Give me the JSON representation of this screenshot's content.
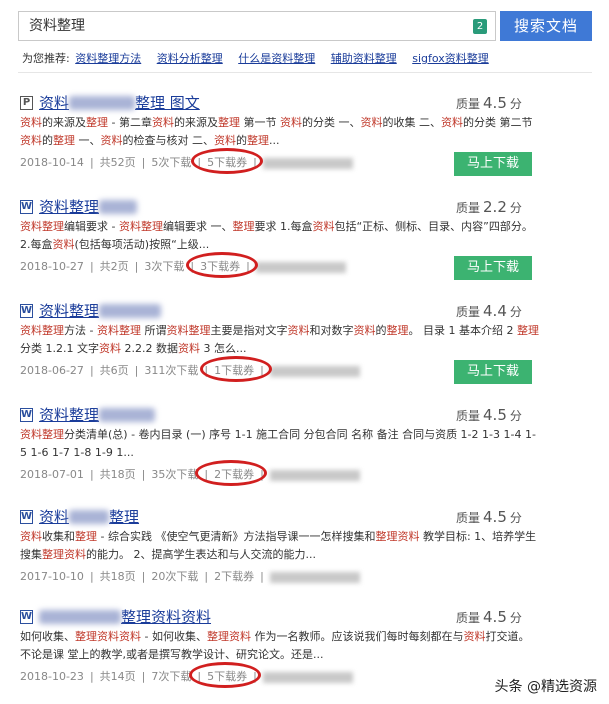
{
  "search": {
    "value": "资料整理",
    "count": "2",
    "button": "搜索文档"
  },
  "suggest": {
    "label": "为您推荐:",
    "links": [
      "资料整理方法",
      "资料分析整理",
      "什么是资料整理",
      "辅助资料整理",
      "sigfox资料整理"
    ]
  },
  "quality_label": "质量",
  "score_unit": "分",
  "download_button": "马上下载",
  "results": [
    {
      "icon": "P",
      "title_a": "资料",
      "title_b": "整理 图文",
      "score": "4.5",
      "snippet": "资料的来源及整理 - 第二章资料的来源及整理 第一节 资料的分类 一、资料的收集 二、资料的分类 第二节 资料的整理 一、资料的检查与核对 二、资料的整理...",
      "date": "2018-10-14",
      "pages": "共52页",
      "downloads": "5次下载",
      "coupon": "5下载券"
    },
    {
      "icon": "W",
      "title_a": "资料整理",
      "title_b": "",
      "score": "2.2",
      "snippet": "资料整理编辑要求 - 资料整理编辑要求 一、整理要求 1.每盒资料包括“正标、侧标、目录、内容”四部分。 2.每盒资料(包括每项活动)按照“上级...",
      "date": "2018-10-27",
      "pages": "共2页",
      "downloads": "3次下载",
      "coupon": "3下载券"
    },
    {
      "icon": "W",
      "title_a": "资料整理",
      "title_b": "",
      "score": "4.4",
      "snippet": "资料整理方法 - 资料整理 所谓资料整理主要是指对文字资料和对数字资料的整理。 目录 1 基本介绍 2 整理分类 1.2.1 文字资料 2.2.2 数据资料 3 怎么...",
      "date": "2018-06-27",
      "pages": "共6页",
      "downloads": "311次下载",
      "coupon": "1下载券"
    },
    {
      "icon": "W",
      "title_a": "资料整理",
      "title_b": "",
      "score": "4.5",
      "snippet": "资料整理分类清单(总) - 卷内目录 (一) 序号 1-1 施工合同 分包合同 名称 备注 合同与资质 1-2 1-3 1-4 1-5 1-6 1-7 1-8 1-9 1...",
      "date": "2018-07-01",
      "pages": "共18页",
      "downloads": "35次下载",
      "coupon": "2下载券"
    },
    {
      "icon": "W",
      "title_a": "资料",
      "title_b": "整理",
      "score": "4.5",
      "snippet": "资料收集和整理 - 综合实践 《使空气更清新》方法指导课一一怎样搜集和整理资料 教学目标: 1、培养学生搜集整理资料的能力。 2、提高学生表达和与人交流的能力...",
      "date": "2017-10-10",
      "pages": "共18页",
      "downloads": "20次下载",
      "coupon": "2下载券"
    },
    {
      "icon": "W",
      "title_a": "",
      "title_b": "整理资料资料",
      "score": "4.5",
      "snippet": "如何收集、整理资料资料 - 如何收集、整理资料 作为一名教师。应该说我们每时每刻都在与资料打交道。不论是课 堂上的教学,或者是撰写教学设计、研究论文。还是...",
      "date": "2018-10-23",
      "pages": "共14页",
      "downloads": "7次下载",
      "coupon": "5下载券"
    }
  ],
  "watermark": "头条 @精选资源"
}
